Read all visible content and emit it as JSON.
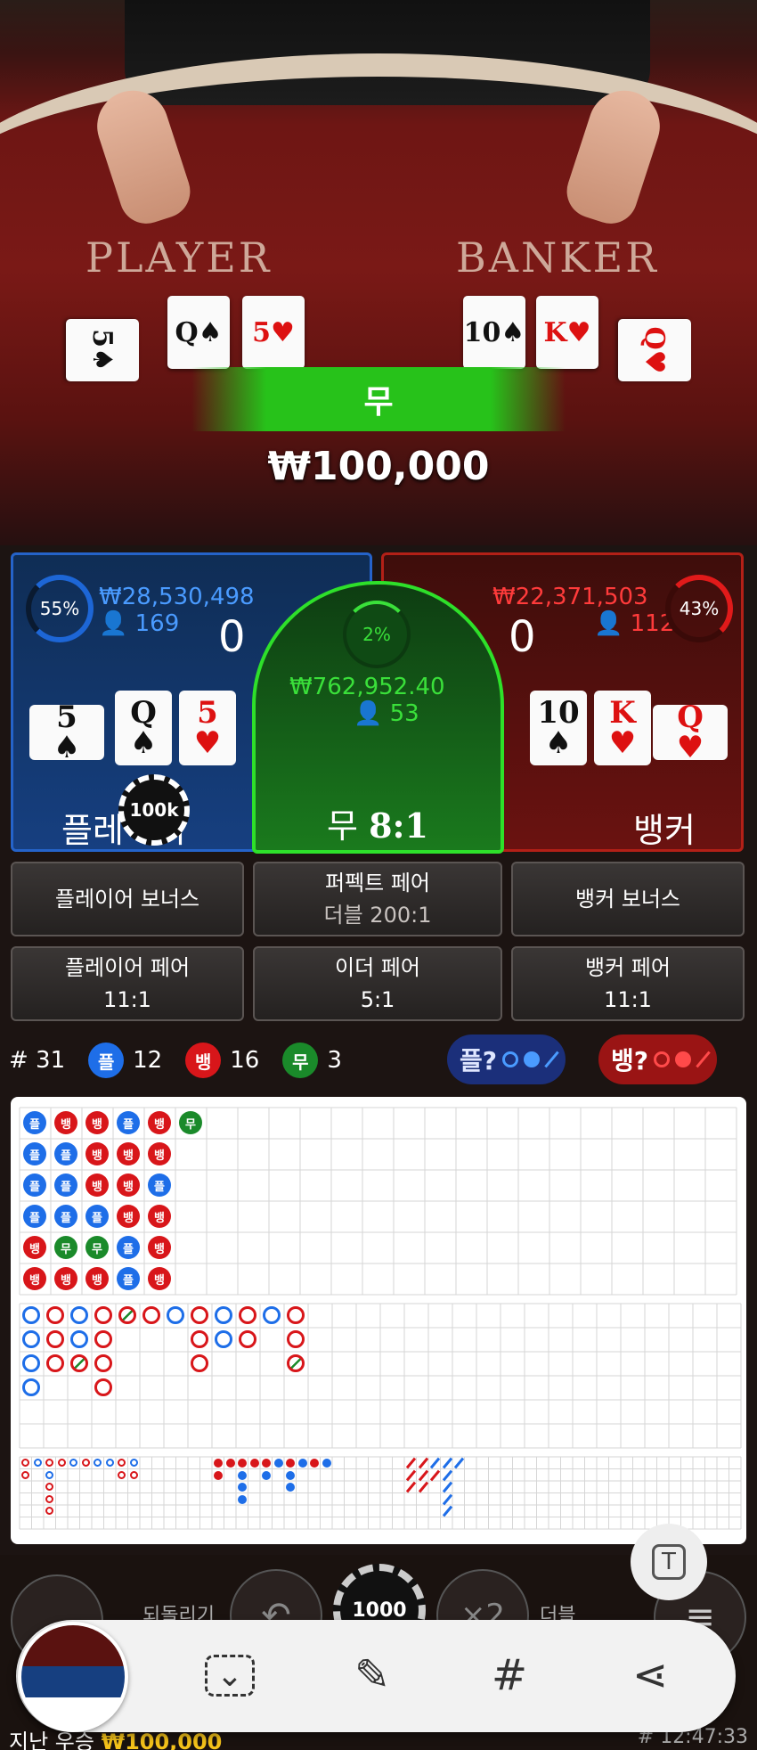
{
  "table": {
    "player_label": "PLAYER",
    "banker_label": "BANKER",
    "player_cards": [
      {
        "rank": "5",
        "suit": "♠"
      },
      {
        "rank": "Q",
        "suit": "♠"
      },
      {
        "rank": "5",
        "suit": "♥"
      }
    ],
    "banker_cards": [
      {
        "rank": "10",
        "suit": "♠"
      },
      {
        "rank": "K",
        "suit": "♥"
      },
      {
        "rank": "Q",
        "suit": "♥"
      }
    ],
    "result_label": "무",
    "win_amount": "₩100,000"
  },
  "player_panel": {
    "percent": "55%",
    "percent_value": 0.55,
    "amount": "₩28,530,498",
    "players": "169",
    "score": "0",
    "cards": [
      {
        "rank": "5",
        "suit": "♠"
      },
      {
        "rank": "Q",
        "suit": "♠"
      },
      {
        "rank": "5",
        "suit": "♥"
      }
    ],
    "label": "플레이어",
    "chip": "100k"
  },
  "tie_panel": {
    "percent": "2%",
    "percent_value": 0.02,
    "amount": "₩762,952.40",
    "players": "53",
    "label": "무",
    "payout": "8:1"
  },
  "banker_panel": {
    "percent": "43%",
    "percent_value": 0.43,
    "amount": "₩22,371,503",
    "players": "112",
    "score": "0",
    "cards": [
      {
        "rank": "10",
        "suit": "♠"
      },
      {
        "rank": "K",
        "suit": "♥"
      },
      {
        "rank": "Q",
        "suit": "♥"
      }
    ],
    "label": "뱅커"
  },
  "side_bets": {
    "player_bonus": "플레이어 보너스",
    "perfect_pair": "퍼펙트 페어",
    "perfect_pair_sub": "더블 200:1",
    "banker_bonus": "뱅커 보너스",
    "player_pair": "플레이어 페어",
    "player_pair_payout": "11:1",
    "either_pair": "이더 페어",
    "either_pair_payout": "5:1",
    "banker_pair": "뱅커 페어",
    "banker_pair_payout": "11:1"
  },
  "stats": {
    "round": "# 31",
    "player_icon": "플",
    "player_count": "12",
    "banker_icon": "뱅",
    "banker_count": "16",
    "tie_icon": "무",
    "tie_count": "3",
    "player_predict": "플?",
    "banker_predict": "뱅?"
  },
  "bead_road": [
    [
      "플",
      "플",
      "플",
      "플",
      "뱅",
      "뱅"
    ],
    [
      "뱅",
      "플",
      "플",
      "플",
      "무",
      "뱅"
    ],
    [
      "뱅",
      "뱅",
      "뱅",
      "플",
      "무",
      "뱅"
    ],
    [
      "플",
      "뱅",
      "뱅",
      "뱅",
      "플",
      "플"
    ],
    [
      "뱅",
      "뱅",
      "플",
      "뱅",
      "뱅",
      "뱅"
    ],
    [
      "무"
    ]
  ],
  "controls": {
    "undo_label": "되돌리기",
    "chip_value": "1000",
    "double_label": "더블",
    "double_icon": "×2"
  },
  "footer": {
    "last_win_label": "지난 우승",
    "last_win_amount": "₩100,000",
    "round_time": "# 12:47:33"
  },
  "colors": {
    "player": "#1e6ee8",
    "banker": "#d8161a",
    "tie": "#1a8a2a"
  }
}
